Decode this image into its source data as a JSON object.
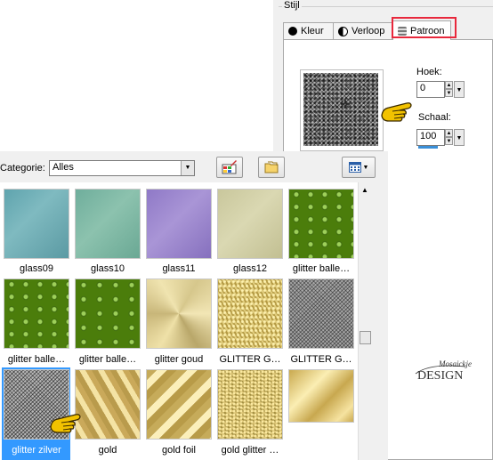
{
  "style_panel": {
    "title": "Stijl",
    "tabs": [
      {
        "label": "Kleur",
        "icon": "filled-circle-icon"
      },
      {
        "label": "Verloop",
        "icon": "half-circle-icon"
      },
      {
        "label": "Patroon",
        "icon": "pattern-icon",
        "selected": true
      }
    ],
    "hoek_label": "Hoek:",
    "hoek_value": "0",
    "schaal_label": "Schaal:",
    "schaal_value": "100"
  },
  "picker": {
    "category_label": "Categorie:",
    "category_value": "Alles",
    "items": [
      {
        "label": "glass09"
      },
      {
        "label": "glass10"
      },
      {
        "label": "glass11"
      },
      {
        "label": "glass12"
      },
      {
        "label": "glitter balle…"
      },
      {
        "label": "glitter balle…"
      },
      {
        "label": "glitter balle…"
      },
      {
        "label": "glitter goud"
      },
      {
        "label": "GLITTER G…"
      },
      {
        "label": "GLITTER G…"
      },
      {
        "label": "glitter zilver",
        "selected": true
      },
      {
        "label": "gold"
      },
      {
        "label": "gold foil"
      },
      {
        "label": "gold glitter …"
      },
      {
        "label": ""
      }
    ]
  },
  "logo_text": "Mosaickje Design",
  "colors": {
    "highlight_red": "#e8283c",
    "selection_blue": "#3399ff",
    "pointer_yellow": "#f2c200"
  }
}
